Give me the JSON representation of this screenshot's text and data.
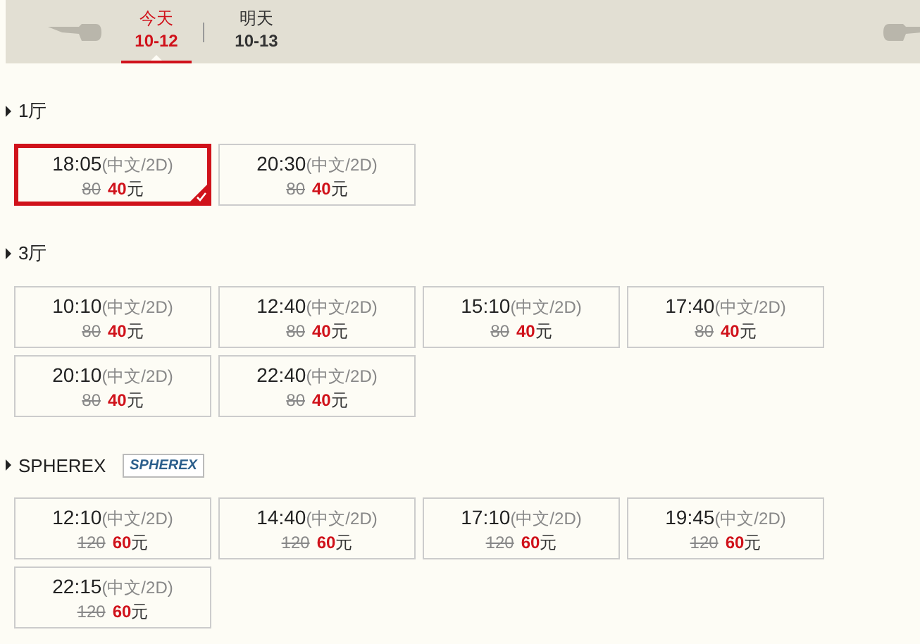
{
  "date_tabs": [
    {
      "day": "今天",
      "date": "10-12",
      "selected": true
    },
    {
      "day": "明天",
      "date": "10-13",
      "selected": false
    }
  ],
  "halls": [
    {
      "name": "1厅",
      "sessions": [
        {
          "time": "18:05",
          "format": "(中文/2D)",
          "old_price": "80",
          "price": "40",
          "unit": "元",
          "selected": true
        },
        {
          "time": "20:30",
          "format": "(中文/2D)",
          "old_price": "80",
          "price": "40",
          "unit": "元",
          "selected": false
        }
      ]
    },
    {
      "name": "3厅",
      "sessions": [
        {
          "time": "10:10",
          "format": "(中文/2D)",
          "old_price": "80",
          "price": "40",
          "unit": "元",
          "selected": false
        },
        {
          "time": "12:40",
          "format": "(中文/2D)",
          "old_price": "80",
          "price": "40",
          "unit": "元",
          "selected": false
        },
        {
          "time": "15:10",
          "format": "(中文/2D)",
          "old_price": "80",
          "price": "40",
          "unit": "元",
          "selected": false
        },
        {
          "time": "17:40",
          "format": "(中文/2D)",
          "old_price": "80",
          "price": "40",
          "unit": "元",
          "selected": false
        },
        {
          "time": "20:10",
          "format": "(中文/2D)",
          "old_price": "80",
          "price": "40",
          "unit": "元",
          "selected": false
        },
        {
          "time": "22:40",
          "format": "(中文/2D)",
          "old_price": "80",
          "price": "40",
          "unit": "元",
          "selected": false
        }
      ]
    },
    {
      "name": "SPHEREX",
      "logo": "SPHEREX",
      "sessions": [
        {
          "time": "12:10",
          "format": "(中文/2D)",
          "old_price": "120",
          "price": "60",
          "unit": "元",
          "selected": false
        },
        {
          "time": "14:40",
          "format": "(中文/2D)",
          "old_price": "120",
          "price": "60",
          "unit": "元",
          "selected": false
        },
        {
          "time": "17:10",
          "format": "(中文/2D)",
          "old_price": "120",
          "price": "60",
          "unit": "元",
          "selected": false
        },
        {
          "time": "19:45",
          "format": "(中文/2D)",
          "old_price": "120",
          "price": "60",
          "unit": "元",
          "selected": false
        },
        {
          "time": "22:15",
          "format": "(中文/2D)",
          "old_price": "120",
          "price": "60",
          "unit": "元",
          "selected": false
        }
      ]
    }
  ]
}
